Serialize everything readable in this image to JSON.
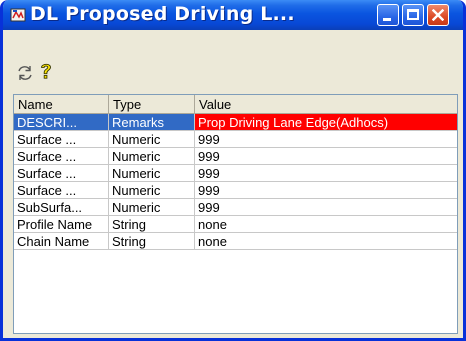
{
  "window": {
    "title": "DL Proposed Driving L...",
    "title_bar_color": "#0a55e0",
    "close_button_color": "#dc4a26"
  },
  "toolbar": {
    "refresh_icon": "refresh-arrows-icon",
    "help_icon": "question-mark-icon"
  },
  "table": {
    "columns": [
      "Name",
      "Type",
      "Value"
    ],
    "rows": [
      {
        "name": "DESCRI...",
        "type": "Remarks",
        "value": "Prop Driving Lane Edge(Adhocs)",
        "selected": true
      },
      {
        "name": "Surface ...",
        "type": "Numeric",
        "value": "999"
      },
      {
        "name": "Surface ...",
        "type": "Numeric",
        "value": "999"
      },
      {
        "name": "Surface ...",
        "type": "Numeric",
        "value": "999"
      },
      {
        "name": "Surface ...",
        "type": "Numeric",
        "value": "999"
      },
      {
        "name": "SubSurfa...",
        "type": "Numeric",
        "value": "999"
      },
      {
        "name": "Profile Name",
        "type": "String",
        "value": "none"
      },
      {
        "name": "Chain Name",
        "type": "String",
        "value": "none"
      }
    ],
    "selected_value_color": "#ff0000",
    "selection_color": "#316ac5"
  }
}
